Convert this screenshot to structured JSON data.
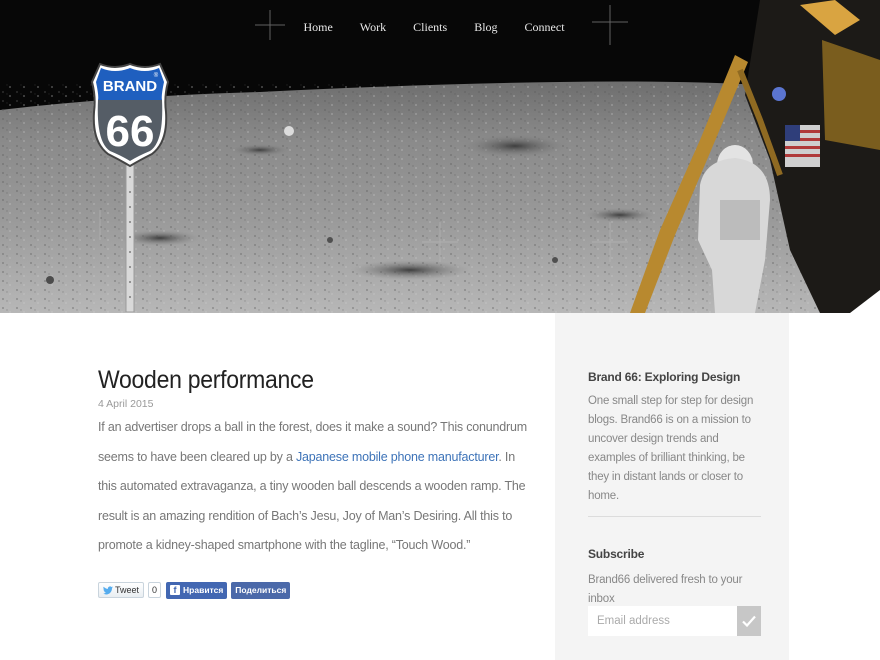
{
  "nav": {
    "items": [
      {
        "label": "Home"
      },
      {
        "label": "Work"
      },
      {
        "label": "Clients"
      },
      {
        "label": "Blog"
      },
      {
        "label": "Connect"
      }
    ]
  },
  "logo": {
    "top_text": "BRAND",
    "number": "66",
    "registered": "®"
  },
  "post": {
    "title": "Wooden performance",
    "date": "4 April 2015",
    "body_before_link": "If an advertiser drops a ball in the forest, does it make a sound? This conundrum seems to have been cleared up by a ",
    "link_text": "Japanese mobile phone manufacturer",
    "body_after_link": ". In this automated extravaganza, a tiny wooden ball descends a wooden ramp. The result is an amazing rendition of Bach’s Jesu, Joy of Man’s Desiring. All this to promote a kidney-shaped smartphone with the tagline, “Touch Wood.”"
  },
  "share": {
    "tweet_label": "Tweet",
    "tweet_count": "0",
    "fb_like_label": "Нравится",
    "fb_share_label": "Поделиться"
  },
  "sidebar": {
    "about_title": "Brand 66: Exploring Design",
    "about_text": "One small step for step for design blogs. Brand66 is on a mission to uncover design trends and examples of brilliant thinking, be they in distant lands or closer to home.",
    "subscribe_title": "Subscribe",
    "subscribe_text": "Brand66 delivered fresh to your inbox",
    "email_placeholder": "Email address",
    "submit_icon": "checkmark-icon"
  },
  "colors": {
    "link": "#3d73b8",
    "sidebar_bg": "#f4f4f4",
    "logo_blue": "#1f5fbf",
    "facebook": "#4267b2"
  }
}
